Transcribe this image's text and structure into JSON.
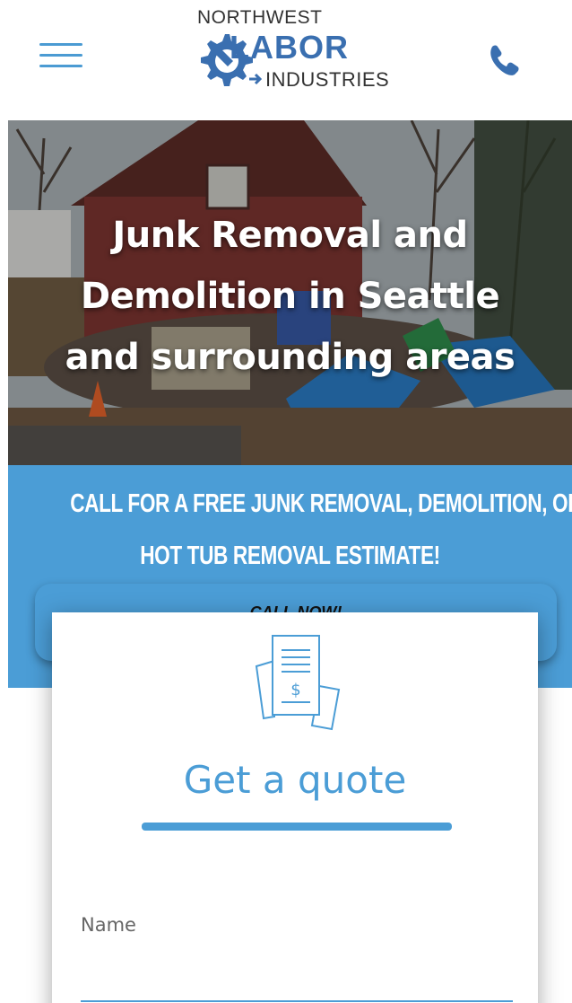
{
  "header": {
    "logo": {
      "top_text": "NORTHWEST",
      "main_text": "LABOR",
      "sub_text": "INDUSTRIES",
      "brand_color": "#3a6fb0"
    },
    "menu_icon": "hamburger-menu-icon",
    "phone_icon": "phone-icon"
  },
  "hero": {
    "title_lines": [
      "Junk Removal and",
      "Demolition in Seattle",
      "and surrounding areas"
    ]
  },
  "banner": {
    "line1": "CALL FOR A FREE JUNK REMOVAL, DEMOLITION, OR",
    "line2": "HOT TUB REMOVAL ESTIMATE!",
    "call_button_label": "CALL NOW!",
    "color": "#4b9dd6"
  },
  "quote_card": {
    "icon": "invoice-dollar-icon",
    "title": "Get a quote",
    "fields": [
      {
        "label": "Name",
        "value": ""
      }
    ]
  }
}
